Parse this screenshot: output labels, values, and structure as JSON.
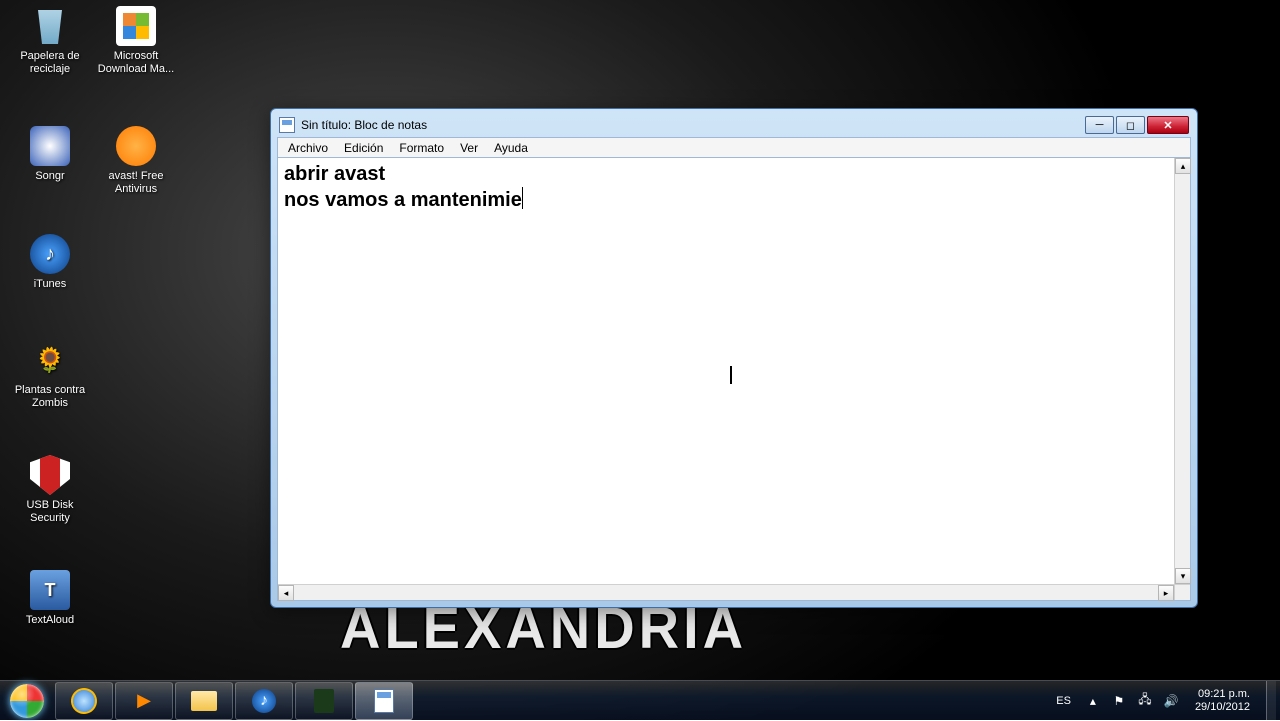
{
  "desktop": {
    "wallpaper_text": "ALEXANDRIA",
    "icons": [
      {
        "label": "Papelera de reciclaje"
      },
      {
        "label": "Microsoft Download Ma..."
      },
      {
        "label": "Songr"
      },
      {
        "label": "avast! Free Antivirus"
      },
      {
        "label": "iTunes"
      },
      {
        "label": "Plantas contra Zombis"
      },
      {
        "label": "USB Disk Security"
      },
      {
        "label": "TextAloud"
      }
    ]
  },
  "notepad": {
    "title": "Sin título: Bloc de notas",
    "menu": {
      "file": "Archivo",
      "edit": "Edición",
      "format": "Formato",
      "view": "Ver",
      "help": "Ayuda"
    },
    "content_line1": "abrir avast",
    "content_line2": "nos vamos a mantenimie",
    "controls": {
      "min": "▁",
      "max": "▢",
      "close": "✕"
    }
  },
  "taskbar": {
    "lang": "ES",
    "time": "09:21 p.m.",
    "date": "29/10/2012"
  }
}
